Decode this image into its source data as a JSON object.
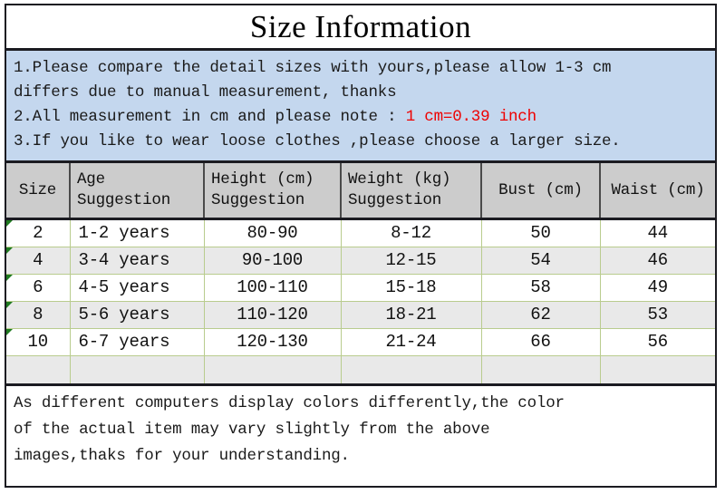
{
  "title": "Size Information",
  "notes": {
    "lines": [
      {
        "text": "1.Please compare the detail sizes with yours,please allow 1-3 cm",
        "highlight": ""
      },
      {
        "text": "differs due to manual measurement, thanks",
        "highlight": ""
      },
      {
        "text": "2.All measurement in cm and please note : ",
        "highlight": "1 cm=0.39 inch"
      },
      {
        "text": "3.If you like to wear loose clothes ,please choose a larger size.",
        "highlight": ""
      }
    ],
    "background_color": "#c4d7ee",
    "highlight_color": "#ee0000"
  },
  "table": {
    "headers": [
      {
        "line1": "Size",
        "line2": "",
        "align": "center"
      },
      {
        "line1": "Age",
        "line2": "Suggestion",
        "align": "left"
      },
      {
        "line1": "Height (cm)",
        "line2": "Suggestion",
        "align": "left"
      },
      {
        "line1": "Weight (kg)",
        "line2": "Suggestion",
        "align": "left"
      },
      {
        "line1": "Bust (cm)",
        "line2": "",
        "align": "center"
      },
      {
        "line1": "Waist (cm)",
        "line2": "",
        "align": "center"
      }
    ],
    "rows": [
      {
        "size": "2",
        "age": "1-2 years",
        "height": "80-90",
        "weight": "8-12",
        "bust": "50",
        "waist": "44"
      },
      {
        "size": "4",
        "age": "3-4 years",
        "height": "90-100",
        "weight": "12-15",
        "bust": "54",
        "waist": "46"
      },
      {
        "size": "6",
        "age": "4-5 years",
        "height": "100-110",
        "weight": "15-18",
        "bust": "58",
        "waist": "49"
      },
      {
        "size": "8",
        "age": "5-6 years",
        "height": "110-120",
        "weight": "18-21",
        "bust": "62",
        "waist": "53"
      },
      {
        "size": "10",
        "age": "6-7 years",
        "height": "120-130",
        "weight": "21-24",
        "bust": "66",
        "waist": "56"
      }
    ],
    "header_background": "#cccccc",
    "alt_row_background": "#e9e9e9",
    "gridline_color": "#b9cc8e",
    "corner_mark_color": "#1f7a1f"
  },
  "footer": {
    "lines": [
      "As different computers display colors differently,the color",
      "of the actual item may vary slightly from the above",
      "images,thaks for your understanding."
    ]
  }
}
